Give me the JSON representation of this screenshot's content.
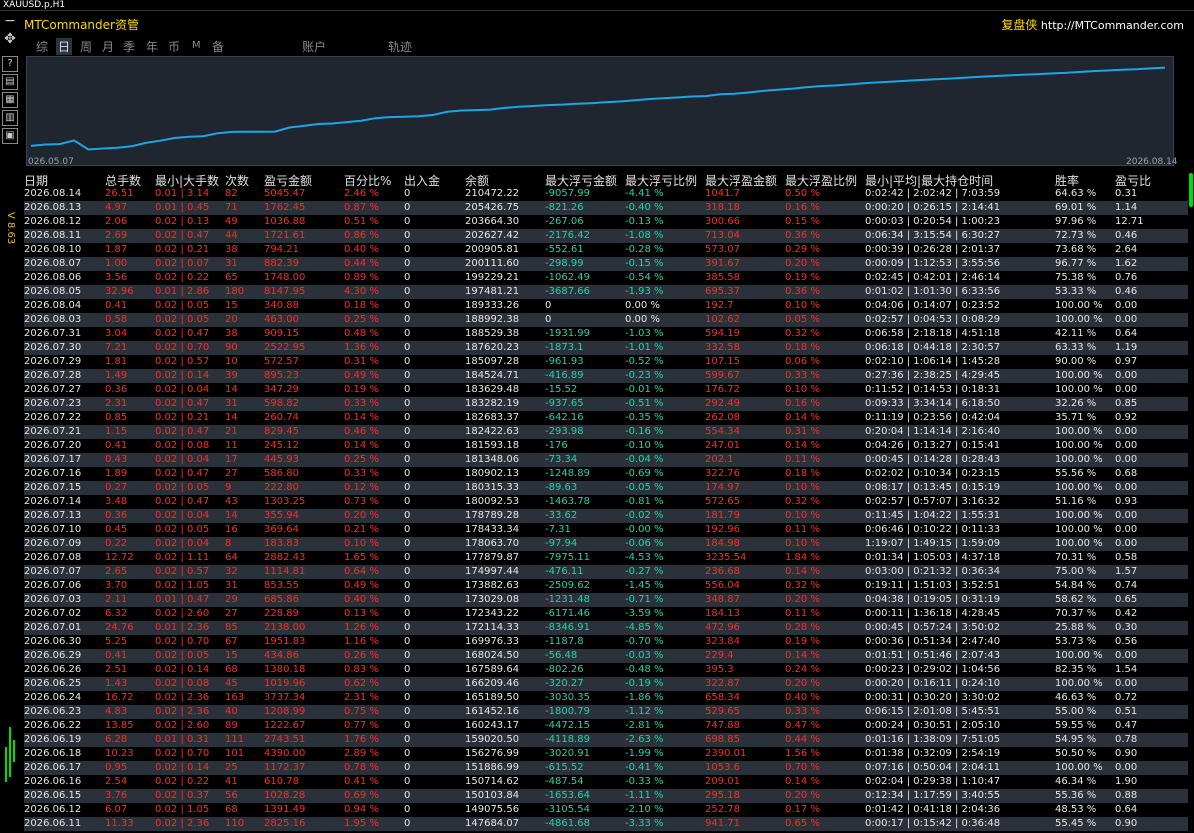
{
  "window": {
    "symbol": "XAUUSD.p,H1"
  },
  "app": {
    "title": "MTCommander资管",
    "right_cn": "复盘侠",
    "right_url": "http://MTCommander.com"
  },
  "side_label": "V 8.63",
  "tabs": [
    {
      "label": "综",
      "active": false
    },
    {
      "label": "日",
      "active": true
    },
    {
      "label": "周",
      "active": false
    },
    {
      "label": "月",
      "active": false
    },
    {
      "label": "季",
      "active": false
    },
    {
      "label": "年",
      "active": false
    },
    {
      "label": "币",
      "active": false
    },
    {
      "label": "M",
      "active": false
    },
    {
      "label": "备",
      "active": false
    },
    {
      "label": "账户",
      "active": false
    },
    {
      "label": "轨迹",
      "active": false
    }
  ],
  "chart_data": {
    "type": "line",
    "x_start_label": "026.05.07",
    "x_end_label": "2026.08.14",
    "y_min": 145000,
    "y_max": 212000,
    "color": "#1aa7e8",
    "values": [
      150500,
      151600,
      151900,
      154800,
      147700,
      148500,
      149100,
      150200,
      152900,
      154600,
      156700,
      157600,
      158100,
      160400,
      161400,
      161500,
      161500,
      161700,
      164900,
      166100,
      167600,
      168000,
      169100,
      170200,
      172100,
      173000,
      173300,
      173700,
      174600,
      177100,
      178100,
      178400,
      178800,
      180100,
      181100,
      181600,
      182300,
      182700,
      183300,
      183700,
      184600,
      185100,
      186000,
      187000,
      187700,
      188200,
      189000,
      189300,
      190800,
      191200,
      192100,
      193400,
      194300,
      195100,
      196200,
      197100,
      197600,
      198400,
      199300,
      200000,
      200600,
      201300,
      201900,
      202500,
      203000,
      203700,
      204300,
      204900,
      205400,
      205900,
      206400,
      206900,
      207400,
      208100,
      208800,
      209300,
      209800,
      210300,
      210900,
      211500
    ]
  },
  "table": {
    "headers": [
      "日期",
      "总手数",
      "最小|大手数",
      "次数",
      "盈亏金额",
      "百分比%",
      "出入金",
      "余额",
      "最大浮亏金额",
      "最大浮亏比例",
      "最大浮盈金额",
      "最大浮盈比例",
      "最小|平均|最大持仓时间",
      "胜率",
      "盈亏比"
    ],
    "rows": [
      [
        "2026.08.14",
        "26.51",
        "0.01 | 3.14",
        "82",
        "5045.47",
        "2.46 %",
        "0",
        "210472.22",
        "-9057.99",
        "-4.41 %",
        "1041.7",
        "0.50 %",
        "0:02:42 | 2:02:42 | 7:03:59",
        "64.63 %",
        "0.31"
      ],
      [
        "2026.08.13",
        "4.97",
        "0.01 | 0.45",
        "71",
        "1762.45",
        "0.87 %",
        "0",
        "205426.75",
        "-821.26",
        "-0.40 %",
        "318.18",
        "0.16 %",
        "0:00:20 | 0:26:15 | 2:14:41",
        "69.01 %",
        "1.14"
      ],
      [
        "2026.08.12",
        "2.06",
        "0.02 | 0.13",
        "49",
        "1036.88",
        "0.51 %",
        "0",
        "203664.30",
        "-267.06",
        "-0.13 %",
        "300.66",
        "0.15 %",
        "0:00:03 | 0:20:54 | 1:00:23",
        "97.96 %",
        "12.71"
      ],
      [
        "2026.08.11",
        "2.69",
        "0.02 | 0.47",
        "44",
        "1721.61",
        "0.86 %",
        "0",
        "202627.42",
        "-2176.42",
        "-1.08 %",
        "713.04",
        "0.36 %",
        "0:06:34 | 3:15:54 | 6:30:27",
        "72.73 %",
        "0.46"
      ],
      [
        "2026.08.10",
        "1.87",
        "0.02 | 0.21",
        "38",
        "794.21",
        "0.40 %",
        "0",
        "200905.81",
        "-552.61",
        "-0.28 %",
        "573.07",
        "0.29 %",
        "0:00:39 | 0:26:28 | 2:01:37",
        "73.68 %",
        "2.64"
      ],
      [
        "2026.08.07",
        "1.00",
        "0.02 | 0.07",
        "31",
        "882.39",
        "0.44 %",
        "0",
        "200111.60",
        "-298.99",
        "-0.15 %",
        "391.67",
        "0.20 %",
        "0:00:09 | 1:12:53 | 3:55:56",
        "96.77 %",
        "1.62"
      ],
      [
        "2026.08.06",
        "3.56",
        "0.02 | 0.22",
        "65",
        "1748.00",
        "0.89 %",
        "0",
        "199229.21",
        "-1062.49",
        "-0.54 %",
        "385.58",
        "0.19 %",
        "0:02:45 | 0:42:01 | 2:46:14",
        "75.38 %",
        "0.76"
      ],
      [
        "2026.08.05",
        "32.96",
        "0.01 | 2.86",
        "180",
        "8147.95",
        "4.30 %",
        "0",
        "197481.21",
        "-3687.66",
        "-1.93 %",
        "695.37",
        "0.36 %",
        "0:01:02 | 1:01:30 | 6:33:56",
        "53.33 %",
        "0.46"
      ],
      [
        "2026.08.04",
        "0.41",
        "0.02 | 0.05",
        "15",
        "340.88",
        "0.18 %",
        "0",
        "189333.26",
        "0",
        "0.00 %",
        "192.7",
        "0.10 %",
        "0:04:06 | 0:14:07 | 0:23:52",
        "100.00 %",
        "0.00"
      ],
      [
        "2026.08.03",
        "0.58",
        "0.02 | 0.05",
        "20",
        "463.00",
        "0.25 %",
        "0",
        "188992.38",
        "0",
        "0.00 %",
        "102.62",
        "0.05 %",
        "0:02:57 | 0:04:53 | 0:08:29",
        "100.00 %",
        "0.00"
      ],
      [
        "2026.07.31",
        "3.04",
        "0.02 | 0.47",
        "38",
        "909.15",
        "0.48 %",
        "0",
        "188529.38",
        "-1931.99",
        "-1.03 %",
        "594.19",
        "0.32 %",
        "0:06:58 | 2:18:18 | 4:51:18",
        "42.11 %",
        "0.64"
      ],
      [
        "2026.07.30",
        "7.21",
        "0.02 | 0.70",
        "90",
        "2522.95",
        "1.36 %",
        "0",
        "187620.23",
        "-1873.1",
        "-1.01 %",
        "332.58",
        "0.18 %",
        "0:06:18 | 0:44:18 | 2:30:57",
        "63.33 %",
        "1.19"
      ],
      [
        "2026.07.29",
        "1.81",
        "0.02 | 0.57",
        "10",
        "572.57",
        "0.31 %",
        "0",
        "185097.28",
        "-961.93",
        "-0.52 %",
        "107.15",
        "0.06 %",
        "0:02:10 | 1:06:14 | 1:45:28",
        "90.00 %",
        "0.97"
      ],
      [
        "2026.07.28",
        "1.49",
        "0.02 | 0.14",
        "39",
        "895.23",
        "0.49 %",
        "0",
        "184524.71",
        "-416.89",
        "-0.23 %",
        "599.67",
        "0.33 %",
        "0:27:36 | 2:38:25 | 4:29:45",
        "100.00 %",
        "0.00"
      ],
      [
        "2026.07.27",
        "0.36",
        "0.02 | 0.04",
        "14",
        "347.29",
        "0.19 %",
        "0",
        "183629.48",
        "-15.52",
        "-0.01 %",
        "176.72",
        "0.10 %",
        "0:11:52 | 0:14:53 | 0:18:31",
        "100.00 %",
        "0.00"
      ],
      [
        "2026.07.23",
        "2.31",
        "0.02 | 0.47",
        "31",
        "598.82",
        "0.33 %",
        "0",
        "183282.19",
        "-937.65",
        "-0.51 %",
        "292.49",
        "0.16 %",
        "0:09:33 | 3:34:14 | 6:18:50",
        "32.26 %",
        "0.85"
      ],
      [
        "2026.07.22",
        "0.85",
        "0.02 | 0.21",
        "14",
        "260.74",
        "0.14 %",
        "0",
        "182683.37",
        "-642.16",
        "-0.35 %",
        "262.08",
        "0.14 %",
        "0:11:19 | 0:23:56 | 0:42:04",
        "35.71 %",
        "0.92"
      ],
      [
        "2026.07.21",
        "1.15",
        "0.02 | 0.47",
        "21",
        "829.45",
        "0.46 %",
        "0",
        "182422.63",
        "-293.98",
        "-0.16 %",
        "554.34",
        "0.31 %",
        "0:20:04 | 1:14:14 | 2:16:40",
        "100.00 %",
        "0.00"
      ],
      [
        "2026.07.20",
        "0.41",
        "0.02 | 0.08",
        "11",
        "245.12",
        "0.14 %",
        "0",
        "181593.18",
        "-176",
        "-0.10 %",
        "247.01",
        "0.14 %",
        "0:04:26 | 0:13:27 | 0:15:41",
        "100.00 %",
        "0.00"
      ],
      [
        "2026.07.17",
        "0.43",
        "0.02 | 0.04",
        "17",
        "445.93",
        "0.25 %",
        "0",
        "181348.06",
        "-73.34",
        "-0.04 %",
        "202.1",
        "0.11 %",
        "0:00:45 | 0:14:28 | 0:28:43",
        "100.00 %",
        "0.00"
      ],
      [
        "2026.07.16",
        "1.89",
        "0.02 | 0.47",
        "27",
        "586.80",
        "0.33 %",
        "0",
        "180902.13",
        "-1248.89",
        "-0.69 %",
        "322.76",
        "0.18 %",
        "0:02:02 | 0:10:34 | 0:23:15",
        "55.56 %",
        "0.68"
      ],
      [
        "2026.07.15",
        "0.27",
        "0.02 | 0.05",
        "9",
        "222.80",
        "0.12 %",
        "0",
        "180315.33",
        "-89.63",
        "-0.05 %",
        "174.97",
        "0.10 %",
        "0:08:17 | 0:13:45 | 0:15:19",
        "100.00 %",
        "0.00"
      ],
      [
        "2026.07.14",
        "3.48",
        "0.02 | 0.47",
        "43",
        "1303.25",
        "0.73 %",
        "0",
        "180092.53",
        "-1463.78",
        "-0.81 %",
        "572.65",
        "0.32 %",
        "0:02:57 | 0:57:07 | 3:16:32",
        "51.16 %",
        "0.93"
      ],
      [
        "2026.07.13",
        "0.36",
        "0.02 | 0.04",
        "14",
        "355.94",
        "0.20 %",
        "0",
        "178789.28",
        "-33.62",
        "-0.02 %",
        "181.79",
        "0.10 %",
        "0:11:45 | 1:04:22 | 1:55:31",
        "100.00 %",
        "0.00"
      ],
      [
        "2026.07.10",
        "0.45",
        "0.02 | 0.05",
        "16",
        "369.64",
        "0.21 %",
        "0",
        "178433.34",
        "-7.31",
        "-0.00 %",
        "192.96",
        "0.11 %",
        "0:06:46 | 0:10:22 | 0:11:33",
        "100.00 %",
        "0.00"
      ],
      [
        "2026.07.09",
        "0.22",
        "0.02 | 0.04",
        "8",
        "183.83",
        "0.10 %",
        "0",
        "178063.70",
        "-97.94",
        "-0.06 %",
        "184.98",
        "0.10 %",
        "1:19:07 | 1:49:15 | 1:59:09",
        "100.00 %",
        "0.00"
      ],
      [
        "2026.07.08",
        "12.72",
        "0.02 | 1.11",
        "64",
        "2882.43",
        "1.65 %",
        "0",
        "177879.87",
        "-7975.11",
        "-4.53 %",
        "3235.54",
        "1.84 %",
        "0:01:34 | 1:05:03 | 4:37:18",
        "70.31 %",
        "0.58"
      ],
      [
        "2026.07.07",
        "2.65",
        "0.02 | 0.57",
        "32",
        "1114.81",
        "0.64 %",
        "0",
        "174997.44",
        "-476.11",
        "-0.27 %",
        "236.68",
        "0.14 %",
        "0:03:00 | 0:21:32 | 0:36:34",
        "75.00 %",
        "1.57"
      ],
      [
        "2026.07.06",
        "3.70",
        "0.02 | 1.05",
        "31",
        "853.55",
        "0.49 %",
        "0",
        "173882.63",
        "-2509.62",
        "-1.45 %",
        "556.04",
        "0.32 %",
        "0:19:11 | 1:51:03 | 3:52:51",
        "54.84 %",
        "0.74"
      ],
      [
        "2026.07.03",
        "2.11",
        "0.01 | 0.47",
        "29",
        "685.86",
        "0.40 %",
        "0",
        "173029.08",
        "-1231.48",
        "-0.71 %",
        "348.87",
        "0.20 %",
        "0:04:38 | 0:19:05 | 0:31:19",
        "58.62 %",
        "0.65"
      ],
      [
        "2026.07.02",
        "6.32",
        "0.02 | 2.60",
        "27",
        "228.89",
        "0.13 %",
        "0",
        "172343.22",
        "-6171.46",
        "-3.59 %",
        "184.13",
        "0.11 %",
        "0:00:11 | 1:36:18 | 4:28:45",
        "70.37 %",
        "0.42"
      ],
      [
        "2026.07.01",
        "24.76",
        "0.01 | 2.36",
        "85",
        "2138.00",
        "1.26 %",
        "0",
        "172114.33",
        "-8346.91",
        "-4.85 %",
        "472.96",
        "0.28 %",
        "0:00:45 | 0:57:24 | 3:50:02",
        "25.88 %",
        "0.30"
      ],
      [
        "2026.06.30",
        "5.25",
        "0.02 | 0.70",
        "67",
        "1951.83",
        "1.16 %",
        "0",
        "169976.33",
        "-1187.8",
        "-0.70 %",
        "323.84",
        "0.19 %",
        "0:00:36 | 0:51:34 | 2:47:40",
        "53.73 %",
        "0.56"
      ],
      [
        "2026.06.29",
        "0.41",
        "0.02 | 0.05",
        "15",
        "434.86",
        "0.26 %",
        "0",
        "168024.50",
        "-56.48",
        "-0.03 %",
        "229.4",
        "0.14 %",
        "0:01:51 | 0:51:46 | 2:07:43",
        "100.00 %",
        "0.00"
      ],
      [
        "2026.06.26",
        "2.51",
        "0.02 | 0.14",
        "68",
        "1380.18",
        "0.83 %",
        "0",
        "167589.64",
        "-802.26",
        "-0.48 %",
        "395.3",
        "0.24 %",
        "0:00:23 | 0:29:02 | 1:04:56",
        "82.35 %",
        "1.54"
      ],
      [
        "2026.06.25",
        "1.43",
        "0.02 | 0.08",
        "45",
        "1019.96",
        "0.62 %",
        "0",
        "166209.46",
        "-320.27",
        "-0.19 %",
        "322.87",
        "0.20 %",
        "0:00:20 | 0:16:11 | 0:24:10",
        "100.00 %",
        "0.00"
      ],
      [
        "2026.06.24",
        "16.72",
        "0.02 | 2.36",
        "163",
        "3737.34",
        "2.31 %",
        "0",
        "165189.50",
        "-3030.35",
        "-1.86 %",
        "658.34",
        "0.40 %",
        "0:00:31 | 0:30:20 | 3:30:02",
        "46.63 %",
        "0.72"
      ],
      [
        "2026.06.23",
        "4.83",
        "0.02 | 2.36",
        "40",
        "1208.99",
        "0.75 %",
        "0",
        "161452.16",
        "-1800.79",
        "-1.12 %",
        "529.65",
        "0.33 %",
        "0:06:15 | 2:01:08 | 5:45:51",
        "55.00 %",
        "0.51"
      ],
      [
        "2026.06.22",
        "13.85",
        "0.02 | 2.60",
        "89",
        "1222.67",
        "0.77 %",
        "0",
        "160243.17",
        "-4472.15",
        "-2.81 %",
        "747.88",
        "0.47 %",
        "0:00:24 | 0:30:51 | 2:05:10",
        "59.55 %",
        "0.47"
      ],
      [
        "2026.06.19",
        "6.28",
        "0.01 | 0.31",
        "111",
        "2743.51",
        "1.76 %",
        "0",
        "159020.50",
        "-4118.89",
        "-2.63 %",
        "698.85",
        "0.44 %",
        "0:01:16 | 1:38:09 | 7:51:05",
        "54.95 %",
        "0.78"
      ],
      [
        "2026.06.18",
        "10.23",
        "0.02 | 0.70",
        "101",
        "4390.00",
        "2.89 %",
        "0",
        "156276.99",
        "-3020.91",
        "-1.99 %",
        "2390.01",
        "1.56 %",
        "0:01:38 | 0:32:09 | 2:54:19",
        "50.50 %",
        "0.90"
      ],
      [
        "2026.06.17",
        "0.95",
        "0.02 | 0.14",
        "25",
        "1172.37",
        "0.78 %",
        "0",
        "151886.99",
        "-615.52",
        "-0.41 %",
        "1053.6",
        "0.70 %",
        "0:07:16 | 0:50:04 | 2:04:11",
        "100.00 %",
        "0.00"
      ],
      [
        "2026.06.16",
        "2.54",
        "0.02 | 0.22",
        "41",
        "610.78",
        "0.41 %",
        "0",
        "150714.62",
        "-487.54",
        "-0.33 %",
        "209.01",
        "0.14 %",
        "0:02:04 | 0:29:38 | 1:10:47",
        "46.34 %",
        "1.90"
      ],
      [
        "2026.06.15",
        "3.76",
        "0.02 | 0.37",
        "56",
        "1028.28",
        "0.69 %",
        "0",
        "150103.84",
        "-1653.64",
        "-1.11 %",
        "295.18",
        "0.20 %",
        "0:12:34 | 1:17:59 | 3:40:55",
        "55.36 %",
        "0.88"
      ],
      [
        "2026.06.12",
        "6.07",
        "0.02 | 1.05",
        "68",
        "1391.49",
        "0.94 %",
        "0",
        "149075.56",
        "-3105.54",
        "-2.10 %",
        "252.78",
        "0.17 %",
        "0:01:42 | 0:41:18 | 2:04:36",
        "48.53 %",
        "0.64"
      ],
      [
        "2026.06.11",
        "11.33",
        "0.02 | 2.36",
        "110",
        "2825.16",
        "1.95 %",
        "0",
        "147684.07",
        "-4861.68",
        "-3.33 %",
        "941.71",
        "0.65 %",
        "0:00:17 | 0:15:42 | 0:36:48",
        "55.45 %",
        "0.90"
      ]
    ]
  },
  "colors": {
    "loss": "#22d3aa",
    "profit": "#ff2a2a",
    "plain": "#e6e6e6",
    "line": "#1aa7e8"
  }
}
